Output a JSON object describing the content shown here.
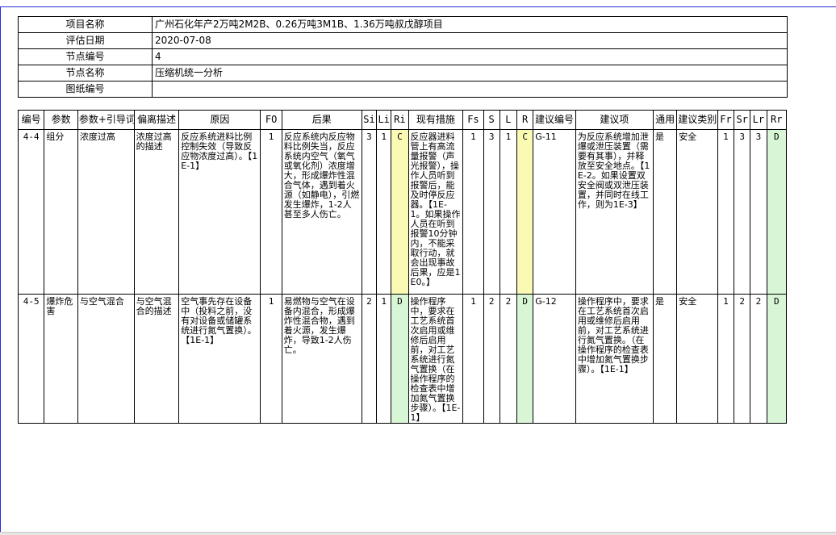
{
  "info": [
    {
      "label": "项目名称",
      "value": "广州石化年产2万吨2M2B、0.26万吨3M1B、1.36万吨叔戊醇项目"
    },
    {
      "label": "评估日期",
      "value": "2020-07-08"
    },
    {
      "label": "节点编号",
      "value": "4"
    },
    {
      "label": "节点名称",
      "value": "压缩机统一分析"
    },
    {
      "label": "图纸编号",
      "value": ""
    }
  ],
  "headers": [
    "编号",
    "参数",
    "参数+引导词",
    "偏离描述",
    "原因",
    "FO",
    "后果",
    "Si",
    "Li",
    "Ri",
    "现有措施",
    "Fs",
    "S",
    "L",
    "R",
    "建议编号",
    "建议项",
    "通用",
    "建议类别",
    "Fr",
    "Sr",
    "Lr",
    "Rr"
  ],
  "rows": [
    {
      "id": "4-4",
      "param": "组分",
      "guideword": "浓度过高",
      "deviation": "浓度过高的描述",
      "cause": "反应系统进料比例控制失效（导致反应物浓度过高）。【1E-1】",
      "fo": "1",
      "consequence": "反应系统内反应物料比例失当，反应系统内空气（氧气或氧化剂）浓度增大，形成爆炸性混合气体，遇到着火源（如静电），引燃发生爆炸，1-2人甚至多人伤亡。",
      "si": "3",
      "li": "1",
      "ri": "C",
      "safeguard": "反应器进料管上有高流量报警（声光报警），操作人员听到报警后，能及时停反应器。【1E-1。如果操作人员在听到报警10分钟内，不能采取行动，就会出现事故后果，应是1E0。】",
      "fs": "1",
      "s": "3",
      "l": "1",
      "r": "C",
      "rec_id": "G-11",
      "recommendation": "为反应系统增加泄爆或泄压装置（需要有其事），并释放至安全地点。【1E-2。如果设置双安全阀或双泄压装置，并同时在线工作，则为1E-3】",
      "general": "是",
      "category": "安全",
      "fr": "1",
      "sr": "3",
      "lr": "3",
      "rr": "D"
    },
    {
      "id": "4-5",
      "param": "爆炸危害",
      "guideword": "与空气混合",
      "deviation": "与空气混合的描述",
      "cause": "空气事先存在设备中（投料之前，没有对设备或储罐系统进行氮气置换）。【1E-1】",
      "fo": "1",
      "consequence": "易燃物与空气在设备内混合，形成爆炸性混合物，遇到着火源，发生爆炸，导致1-2人伤亡。",
      "si": "2",
      "li": "1",
      "ri": "D",
      "safeguard": "操作程序中，要求在工艺系统首次启用或维修后启用前，对工艺系统进行氮气置换（在操作程序的检查表中增加氮气置换步骤）。【1E-1】",
      "fs": "1",
      "s": "2",
      "l": "2",
      "r": "D",
      "rec_id": "G-12",
      "recommendation": "操作程序中，要求在工艺系统首次启用或维修后启用前，对工艺系统进行氮气置换。（在操作程序的检查表中增加氮气置换步骤）。【1E-1】",
      "general": "是",
      "category": "安全",
      "fr": "1",
      "sr": "2",
      "lr": "2",
      "rr": "D"
    }
  ]
}
